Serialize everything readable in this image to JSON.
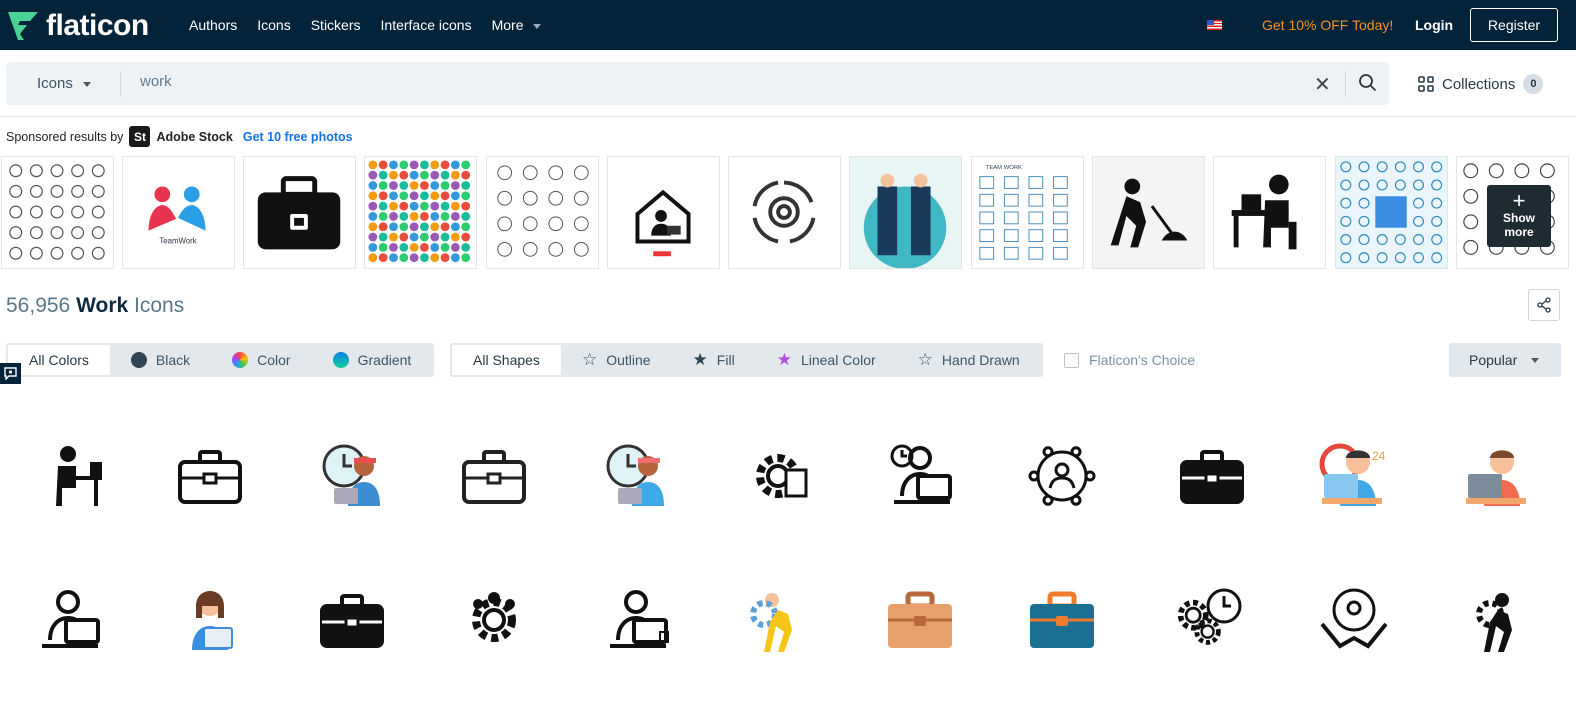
{
  "header": {
    "logo_text": "flaticon",
    "nav": [
      "Authors",
      "Icons",
      "Stickers",
      "Interface icons",
      "More"
    ],
    "promo": "Get 10% OFF Today!",
    "login": "Login",
    "register": "Register",
    "brand_color": "#4ad295",
    "bg_color": "#03233a"
  },
  "search": {
    "type": "Icons",
    "value": "work",
    "collections_label": "Collections",
    "collections_count": "0"
  },
  "sponsored": {
    "label": "Sponsored results by",
    "logo": "St",
    "provider": "Adobe Stock",
    "cta": "Get 10 free photos",
    "thumbs": [
      "line icon set",
      "TeamWork",
      "briefcase",
      "flat icon set",
      "outline icon set",
      "home office",
      "gear cycle",
      "business handshake",
      "TEAM WORK",
      "construction worker",
      "person at desk",
      "blue icon set",
      "line icon set"
    ],
    "show_more": "Show more"
  },
  "results": {
    "count": "56,956",
    "keyword": "Work",
    "suffix": "Icons"
  },
  "filters": {
    "colors": [
      {
        "label": "All Colors",
        "active": true
      },
      {
        "label": "Black",
        "color": "#324554"
      },
      {
        "label": "Color",
        "color": "conic"
      },
      {
        "label": "Gradient",
        "color": "gradient"
      }
    ],
    "shapes": [
      {
        "label": "All Shapes",
        "active": true
      },
      {
        "label": "Outline"
      },
      {
        "label": "Fill"
      },
      {
        "label": "Lineal Color"
      },
      {
        "label": "Hand Drawn"
      }
    ],
    "flaticons_choice": "Flaticon's Choice",
    "sort": "Popular"
  },
  "icons": [
    [
      "person-at-desk",
      "briefcase-outline",
      "worker-clock",
      "briefcase-thin",
      "worker-clock-color",
      "gear-document-person",
      "person-clock-desk",
      "team-network",
      "briefcase-fill",
      "clock-24h-worker",
      "person-computer-color"
    ],
    [
      "person-laptop",
      "woman-laptop-color",
      "briefcase-fill-2",
      "team-gear",
      "person-laptop-coffee",
      "worker-gear-color",
      "briefcase-brown",
      "briefcase-blue",
      "gears-clock",
      "team-handshake",
      "worker-carrying-gear"
    ]
  ]
}
